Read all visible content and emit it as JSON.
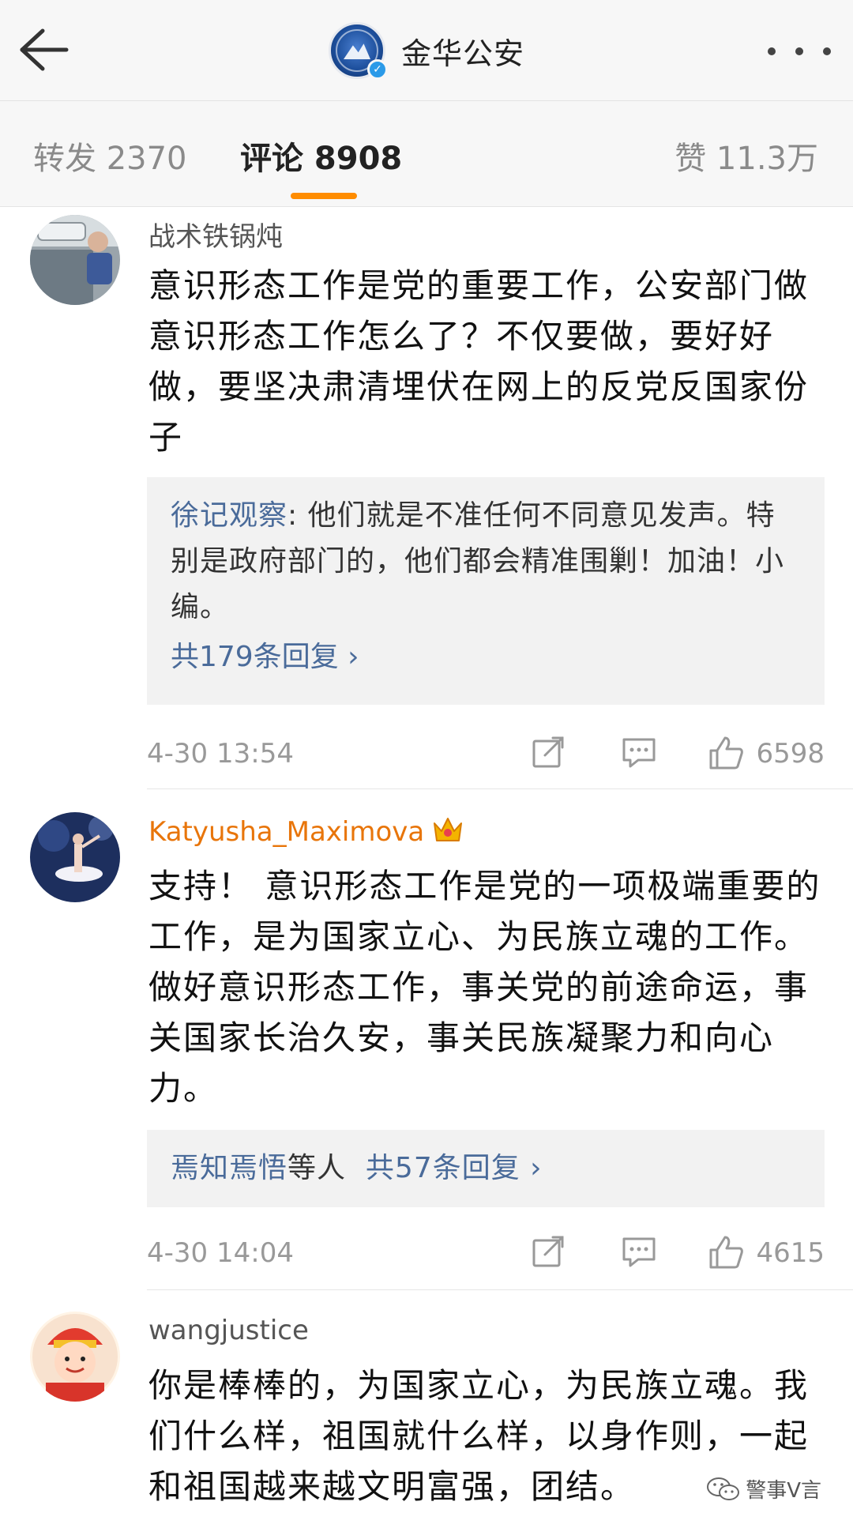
{
  "header": {
    "account_name": "金华公安"
  },
  "tabs": {
    "repost_label": "转发 2370",
    "comment_label": "评论 8908",
    "like_label": "赞 11.3万"
  },
  "comments": [
    {
      "username": "战术铁锅炖",
      "text": "意识形态工作是党的重要工作，公安部门做意识形态工作怎么了？不仅要做，要好好做，要坚决肃清埋伏在网上的反党反国家份子",
      "reply_user": "徐记观察",
      "reply_text": ": 他们就是不准任何不同意见发声。特别是政府部门的，他们都会精准围剿！加油！小编。",
      "reply_count": "共179条回复 ›",
      "time": "4-30 13:54",
      "likes": "6598"
    },
    {
      "username": "Katyusha_Maximova",
      "text": "支持！ 意识形态工作是党的一项极端重要的工作，是为国家立心、为民族立魂的工作。做好意识形态工作，事关党的前途命运，事关国家长治久安，事关民族凝聚力和向心力。",
      "reply_user": "焉知焉悟",
      "reply_others": "等人",
      "reply_count": "共57条回复 ›",
      "time": "4-30 14:04",
      "likes": "4615"
    },
    {
      "username": "wangjustice",
      "text": "你是棒棒的，为国家立心，为民族立魂。我们什么样，祖国就什么样，以身作则，一起和祖国越来越文明富强，团结。"
    }
  ],
  "watermark": "警事V言",
  "icons": {
    "back": "arrow-left-icon",
    "more": "more-dots-icon",
    "repost": "share-icon",
    "reply": "comment-icon",
    "like": "thumbs-up-icon",
    "vip": "crown-icon"
  },
  "colors": {
    "accent": "#ff8c00",
    "link": "#4a6b9a",
    "vip_name": "#e8750a",
    "verified": "#2b9ae8"
  }
}
